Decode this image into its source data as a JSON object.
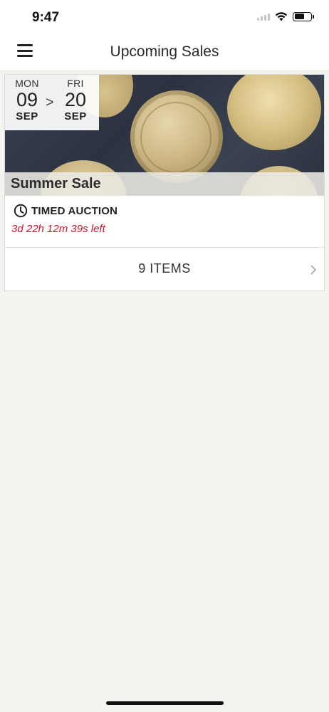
{
  "status_bar": {
    "time": "9:47"
  },
  "nav": {
    "title": "Upcoming Sales",
    "menu_icon": "hamburger-menu-icon"
  },
  "sale": {
    "start": {
      "day": "MON",
      "date": "09",
      "month": "SEP"
    },
    "separator": ">",
    "end": {
      "day": "FRI",
      "date": "20",
      "month": "SEP"
    },
    "title": "Summer Sale",
    "auction_type": "TIMED AUCTION",
    "time_left": "3d 22h 12m 39s left",
    "items_label": "9 ITEMS"
  },
  "colors": {
    "accent_red": "#d0142d",
    "background": "#f4f3ef"
  }
}
